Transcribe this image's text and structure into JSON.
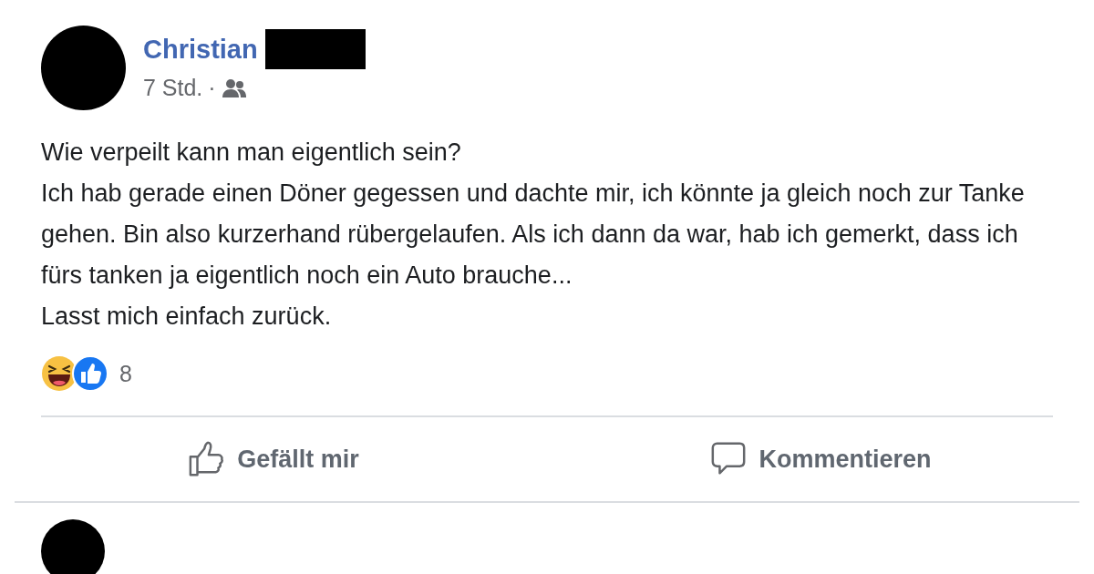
{
  "post": {
    "author": "Christian",
    "time": "7 Std.",
    "separator": "·",
    "paragraphs": [
      "Wie verpeilt kann man eigentlich sein?",
      "Ich hab gerade einen Döner gegessen und dachte mir, ich könnte ja gleich noch zur Tanke gehen. Bin also kurzerhand rübergelaufen. Als ich dann da war, hab ich gemerkt, dass ich fürs tanken ja eigentlich noch ein Auto brauche...",
      "Lasst mich einfach zurück."
    ],
    "reaction_count": "8",
    "actions": [
      {
        "kind": "like",
        "label": "Gefällt mir"
      },
      {
        "kind": "comment",
        "label": "Kommentieren"
      }
    ]
  }
}
